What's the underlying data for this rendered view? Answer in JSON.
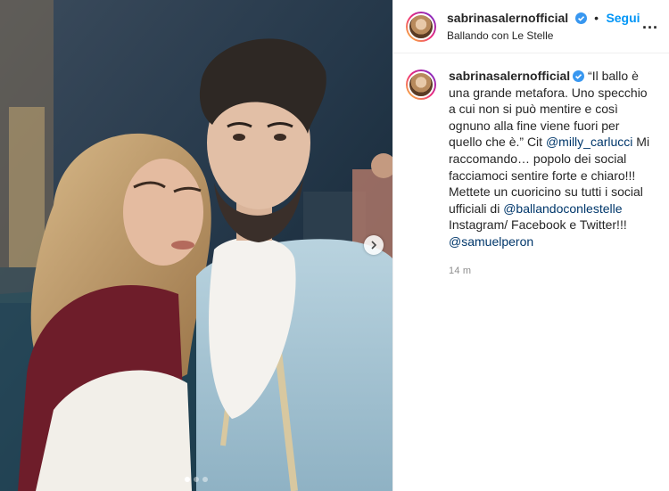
{
  "post": {
    "username": "sabrinasalernofficial",
    "separator": "•",
    "follow_label": "Segui",
    "location": "Ballando con Le Stelle",
    "more_label": "...",
    "caption": {
      "username": "sabrinasalernofficial",
      "part1": " “Il ballo è una grande metafora. Uno specchio a cui non si può mentire e così ognuno alla fine viene fuori per quello che è.” Cit ",
      "mention1": "@milly_carlucci",
      "part2": " Mi raccomando… popolo dei social facciamoci sentire forte e chiaro!!! Mettete un cuoricino su tutti i social ufficiali di ",
      "mention2": "@ballandoconlestelle",
      "part3": " Instagram/ Facebook e Twitter!!! ",
      "mention3": "@samuelperon"
    },
    "timestamp": "14 m"
  },
  "carousel": {
    "slide_count": 3,
    "active_index": 0
  },
  "colors": {
    "link": "#0095f6",
    "mention": "#00376b",
    "verified": "#3897f0",
    "muted": "#8e8e8e"
  },
  "icons": [
    "verified-badge-icon",
    "more-options-icon",
    "chevron-right-icon"
  ]
}
